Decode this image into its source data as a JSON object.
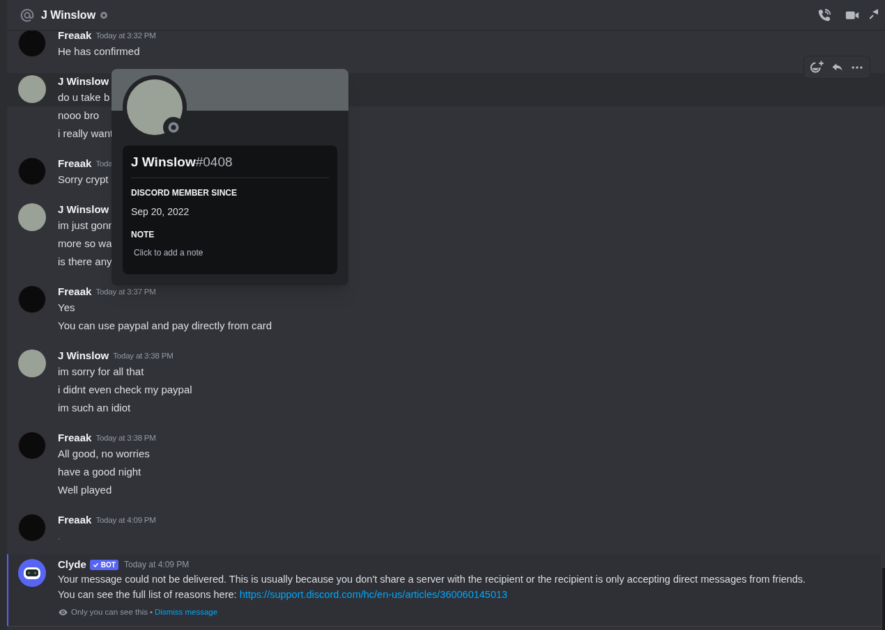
{
  "header": {
    "title": "J Winslow"
  },
  "messages": [
    {
      "author": "Freaak",
      "kind": "logo",
      "timestamp": "Today at 3:32 PM",
      "hovered": false,
      "lines": [
        {
          "text": "He has confirmed",
          "kind": "normal"
        }
      ]
    },
    {
      "author": "J Winslow",
      "kind": "photo",
      "hovered": true,
      "lines": [
        {
          "text": "do u take b",
          "kind": "normal"
        },
        {
          "text": "nooo bro",
          "kind": "normal"
        },
        {
          "text": "i really want",
          "kind": "normal"
        }
      ]
    },
    {
      "author": "Freaak",
      "kind": "logo",
      "timestamp": "Toda",
      "hovered": false,
      "lines": [
        {
          "text": "Sorry crypt",
          "kind": "normal"
        }
      ]
    },
    {
      "author": "J Winslow",
      "kind": "photo",
      "hovered": false,
      "lines": [
        {
          "text": "im just gonn",
          "kind": "normal"
        },
        {
          "text": "more so wa",
          "kind": "normal"
        },
        {
          "text": "is there any",
          "kind": "normal"
        }
      ]
    },
    {
      "author": "Freaak",
      "kind": "logo",
      "timestamp": "Today at 3:37 PM",
      "hovered": false,
      "lines": [
        {
          "text": "Yes",
          "kind": "normal"
        },
        {
          "text": "You can use paypal and pay directly from card",
          "kind": "normal"
        }
      ]
    },
    {
      "author": "J Winslow",
      "kind": "photo",
      "timestamp": "Today at 3:38 PM",
      "hovered": false,
      "lines": [
        {
          "text": "im sorry for all that",
          "kind": "normal"
        },
        {
          "text": "i didnt even check my paypal",
          "kind": "normal"
        },
        {
          "text": "im such an idiot",
          "kind": "normal"
        }
      ]
    },
    {
      "author": "Freaak",
      "kind": "logo",
      "timestamp": "Today at 3:38 PM",
      "hovered": false,
      "lines": [
        {
          "text": "All good, no worries",
          "kind": "normal"
        },
        {
          "text": "have a good night",
          "kind": "normal"
        },
        {
          "text": "Well played",
          "kind": "normal"
        }
      ]
    },
    {
      "author": "Freaak",
      "kind": "logo",
      "timestamp": "Today at 4:09 PM",
      "hovered": false,
      "lines": [
        {
          "text": ".",
          "kind": "failed"
        }
      ]
    }
  ],
  "system_message": {
    "author": "Clyde",
    "badge": "BOT",
    "timestamp": "Today at 4:09 PM",
    "lines": [
      {
        "text": "Your message could not be delivered. This is usually because you don't share a server with the recipient or the recipient is only accepting direct messages from friends."
      },
      {
        "text": "You can see the full list of reasons here:",
        "link": "https://support.discord.com/hc/en-us/articles/360060145013"
      }
    ],
    "footer": {
      "note": "Only you can see this",
      "separator": "•",
      "action": "Dismiss message"
    }
  },
  "profile_popup": {
    "username": "J Winslow",
    "discriminator": "#0408",
    "member_since_label": "DISCORD MEMBER SINCE",
    "member_since": "Sep 20, 2022",
    "note_label": "NOTE",
    "note_placeholder": "Click to add a note"
  }
}
